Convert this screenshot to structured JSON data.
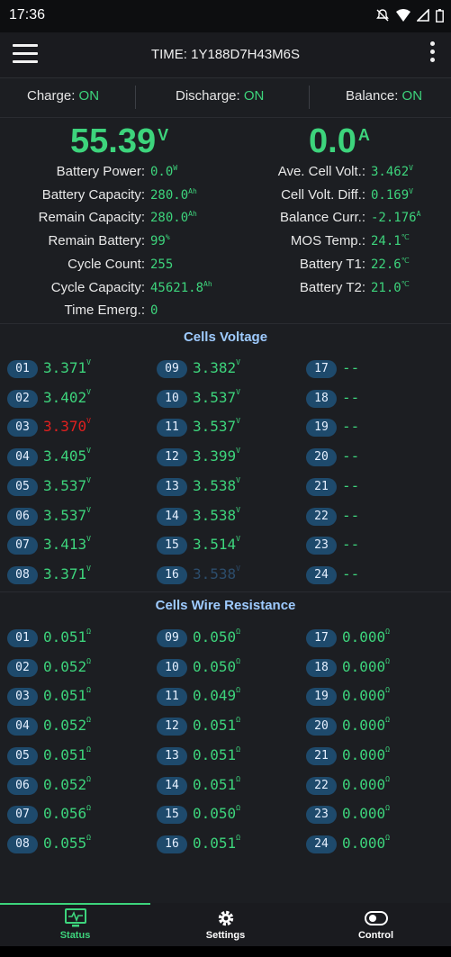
{
  "status_bar": {
    "time": "17:36"
  },
  "toolbar": {
    "title": "TIME: 1Y188D7H43M6S"
  },
  "switches": {
    "charge_label": "Charge:",
    "charge_value": "ON",
    "discharge_label": "Discharge:",
    "discharge_value": "ON",
    "balance_label": "Balance:",
    "balance_value": "ON"
  },
  "main": {
    "voltage": "55.39",
    "voltage_unit": "V",
    "current": "0.0",
    "current_unit": "A"
  },
  "left_stats": [
    {
      "label": "Battery Power:",
      "value": "0.0",
      "unit": "W"
    },
    {
      "label": "Battery Capacity:",
      "value": "280.0",
      "unit": "Ah"
    },
    {
      "label": "Remain Capacity:",
      "value": "280.0",
      "unit": "Ah"
    },
    {
      "label": "Remain Battery:",
      "value": "99",
      "unit": "%"
    },
    {
      "label": "Cycle Count:",
      "value": "255",
      "unit": ""
    },
    {
      "label": "Cycle Capacity:",
      "value": "45621.8",
      "unit": "Ah"
    },
    {
      "label": "Time Emerg.:",
      "value": "0",
      "unit": ""
    }
  ],
  "right_stats": [
    {
      "label": "Ave. Cell Volt.:",
      "value": "3.462",
      "unit": "V"
    },
    {
      "label": "Cell Volt. Diff.:",
      "value": "0.169",
      "unit": "V"
    },
    {
      "label": "Balance Curr.:",
      "value": "-2.176",
      "unit": "A"
    },
    {
      "label": "MOS Temp.:",
      "value": "24.1",
      "unit": "℃"
    },
    {
      "label": "Battery T1:",
      "value": "22.6",
      "unit": "℃"
    },
    {
      "label": "Battery T2:",
      "value": "21.0",
      "unit": "℃"
    }
  ],
  "cells_voltage": {
    "title": "Cells Voltage",
    "unit": "V",
    "cells": [
      {
        "id": "01",
        "value": "3.371",
        "state": "normal"
      },
      {
        "id": "02",
        "value": "3.402",
        "state": "normal"
      },
      {
        "id": "03",
        "value": "3.370",
        "state": "low"
      },
      {
        "id": "04",
        "value": "3.405",
        "state": "normal"
      },
      {
        "id": "05",
        "value": "3.537",
        "state": "normal"
      },
      {
        "id": "06",
        "value": "3.537",
        "state": "normal"
      },
      {
        "id": "07",
        "value": "3.413",
        "state": "normal"
      },
      {
        "id": "08",
        "value": "3.371",
        "state": "normal"
      },
      {
        "id": "09",
        "value": "3.382",
        "state": "normal"
      },
      {
        "id": "10",
        "value": "3.537",
        "state": "normal"
      },
      {
        "id": "11",
        "value": "3.537",
        "state": "normal"
      },
      {
        "id": "12",
        "value": "3.399",
        "state": "normal"
      },
      {
        "id": "13",
        "value": "3.538",
        "state": "normal"
      },
      {
        "id": "14",
        "value": "3.538",
        "state": "normal"
      },
      {
        "id": "15",
        "value": "3.514",
        "state": "normal"
      },
      {
        "id": "16",
        "value": "3.538",
        "state": "high"
      },
      {
        "id": "17",
        "value": "--",
        "state": "empty"
      },
      {
        "id": "18",
        "value": "--",
        "state": "empty"
      },
      {
        "id": "19",
        "value": "--",
        "state": "empty"
      },
      {
        "id": "20",
        "value": "--",
        "state": "empty"
      },
      {
        "id": "21",
        "value": "--",
        "state": "empty"
      },
      {
        "id": "22",
        "value": "--",
        "state": "empty"
      },
      {
        "id": "23",
        "value": "--",
        "state": "empty"
      },
      {
        "id": "24",
        "value": "--",
        "state": "empty"
      }
    ]
  },
  "wire_resistance": {
    "title": "Cells Wire Resistance",
    "unit": "Ω",
    "cells": [
      {
        "id": "01",
        "value": "0.051"
      },
      {
        "id": "02",
        "value": "0.052"
      },
      {
        "id": "03",
        "value": "0.051"
      },
      {
        "id": "04",
        "value": "0.052"
      },
      {
        "id": "05",
        "value": "0.051"
      },
      {
        "id": "06",
        "value": "0.052"
      },
      {
        "id": "07",
        "value": "0.056"
      },
      {
        "id": "08",
        "value": "0.055"
      },
      {
        "id": "09",
        "value": "0.050"
      },
      {
        "id": "10",
        "value": "0.050"
      },
      {
        "id": "11",
        "value": "0.049"
      },
      {
        "id": "12",
        "value": "0.051"
      },
      {
        "id": "13",
        "value": "0.051"
      },
      {
        "id": "14",
        "value": "0.051"
      },
      {
        "id": "15",
        "value": "0.050"
      },
      {
        "id": "16",
        "value": "0.051"
      },
      {
        "id": "17",
        "value": "0.000"
      },
      {
        "id": "18",
        "value": "0.000"
      },
      {
        "id": "19",
        "value": "0.000"
      },
      {
        "id": "20",
        "value": "0.000"
      },
      {
        "id": "21",
        "value": "0.000"
      },
      {
        "id": "22",
        "value": "0.000"
      },
      {
        "id": "23",
        "value": "0.000"
      },
      {
        "id": "24",
        "value": "0.000"
      }
    ]
  },
  "bottom_nav": [
    {
      "label": "Status",
      "icon": "monitor-icon",
      "active": true
    },
    {
      "label": "Settings",
      "icon": "gear-icon",
      "active": false
    },
    {
      "label": "Control",
      "icon": "toggle-icon",
      "active": false
    }
  ],
  "colors": {
    "accent": "#3dd47c",
    "low_cell": "#e0201f",
    "high_cell": "#2c4d6c",
    "badge": "#1e4a6c",
    "section_title": "#9ecbff"
  }
}
